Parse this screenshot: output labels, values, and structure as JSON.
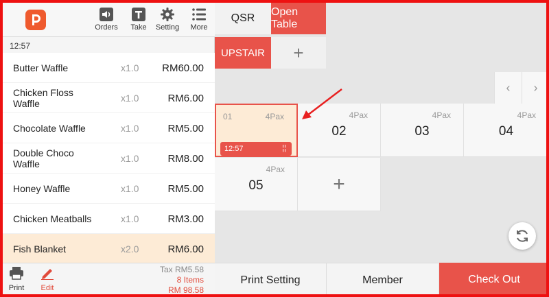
{
  "topbar": {
    "buttons": [
      {
        "label": "Orders",
        "icon": "speaker-icon"
      },
      {
        "label": "Take",
        "icon": "take-icon"
      },
      {
        "label": "Setting",
        "icon": "gear-icon"
      },
      {
        "label": "More",
        "icon": "menu-list-icon"
      }
    ]
  },
  "order": {
    "time": "12:57",
    "items": [
      {
        "name": "Butter Waffle",
        "qty": "x1.0",
        "price": "RM60.00"
      },
      {
        "name": "Chicken Floss Waffle",
        "qty": "x1.0",
        "price": "RM6.00"
      },
      {
        "name": "Chocolate Waffle",
        "qty": "x1.0",
        "price": "RM5.00"
      },
      {
        "name": "Double Choco Waffle",
        "qty": "x1.0",
        "price": "RM8.00"
      },
      {
        "name": "Honey Waffle",
        "qty": "x1.0",
        "price": "RM5.00"
      },
      {
        "name": "Chicken Meatballs",
        "qty": "x1.0",
        "price": "RM3.00"
      },
      {
        "name": "Fish Blanket",
        "qty": "x2.0",
        "price": "RM6.00"
      }
    ]
  },
  "bottom": {
    "print_label": "Print",
    "edit_label": "Edit",
    "tax": "Tax RM5.58",
    "items_count": "8 Items",
    "total": "RM 98.58"
  },
  "tabs": {
    "qsr": "QSR",
    "open_table": "Open Table"
  },
  "areas": {
    "upstair": "UPSTAIR",
    "add": "+"
  },
  "pager": {
    "prev": "‹",
    "next": "›"
  },
  "tables": {
    "t1": {
      "id": "01",
      "pax": "4Pax",
      "time": "12:57",
      "icon": "fork-knife-icon"
    },
    "t2": {
      "number": "02",
      "pax": "4Pax"
    },
    "t3": {
      "number": "03",
      "pax": "4Pax"
    },
    "t4": {
      "number": "04",
      "pax": "4Pax"
    },
    "t5": {
      "number": "05",
      "pax": "4Pax"
    },
    "add": "+"
  },
  "actions": {
    "print_setting": "Print Setting",
    "member": "Member",
    "checkout": "Check Out"
  },
  "colors": {
    "accent": "#e8534a",
    "selected": "#fdebd6",
    "frame": "#ee1111"
  }
}
